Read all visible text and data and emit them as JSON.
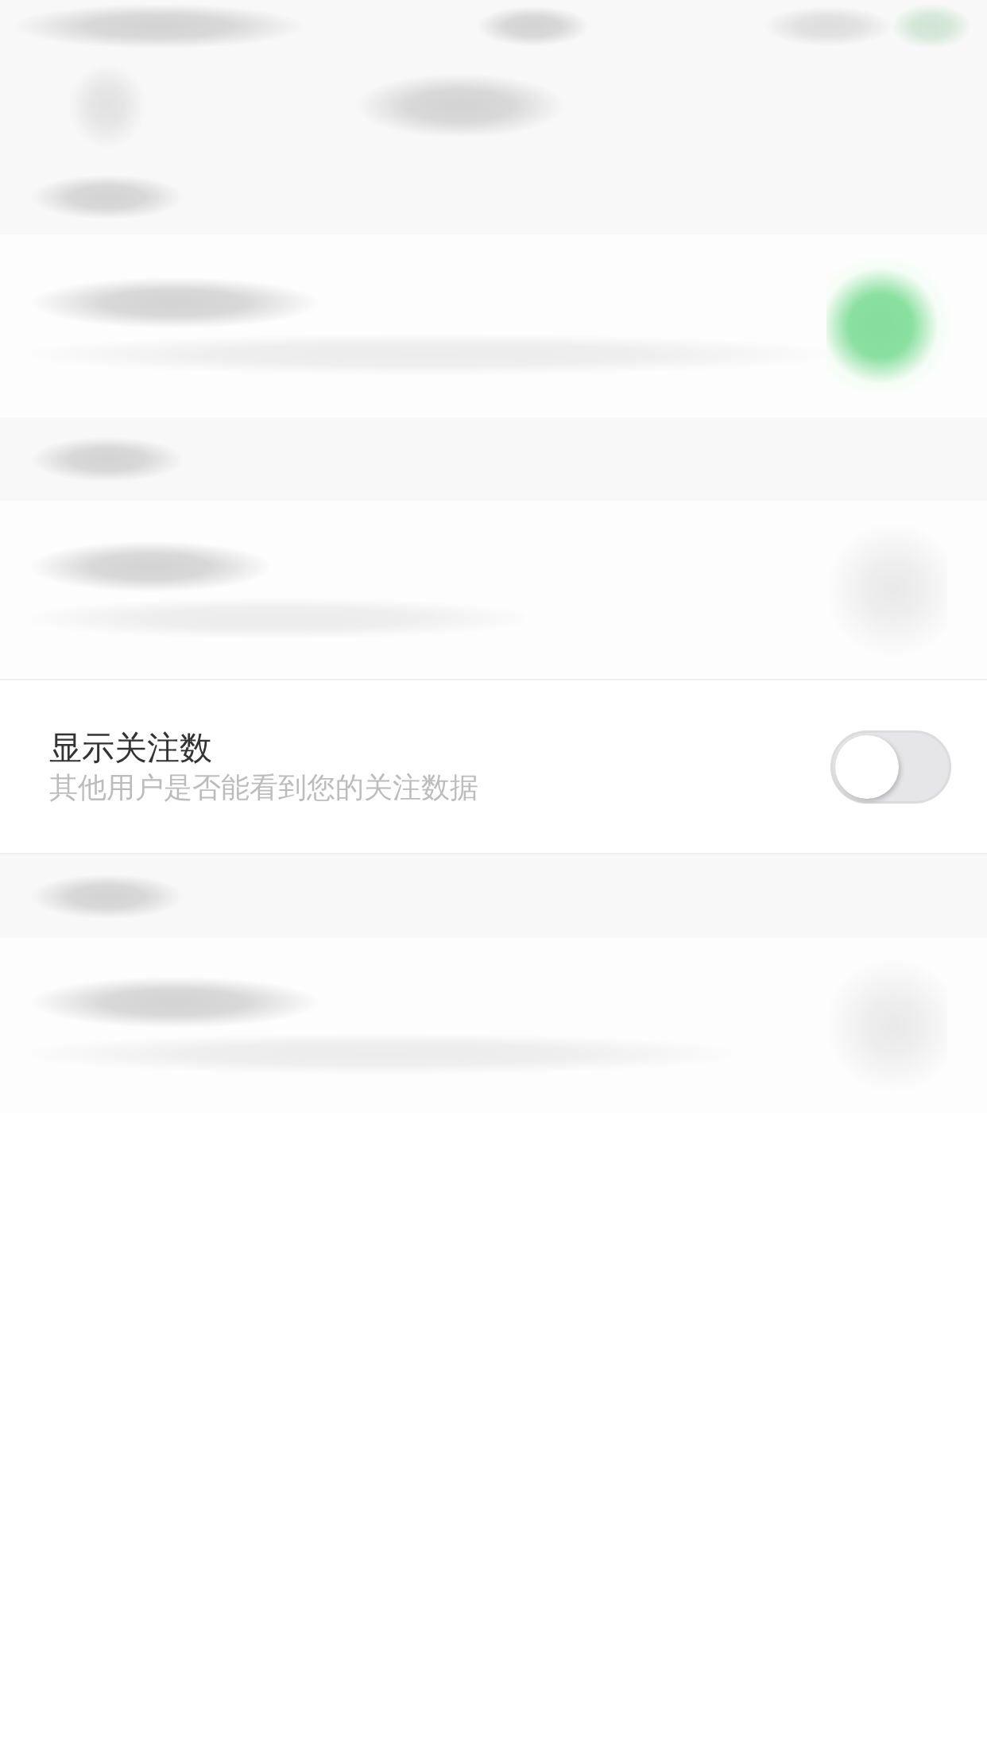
{
  "sections": [
    {
      "rows": [
        {
          "kind": "blurred",
          "on": true
        }
      ]
    },
    {
      "rows": [
        {
          "kind": "blurred",
          "on": false
        },
        {
          "kind": "visible",
          "title": "显示关注数",
          "subtitle": "其他用户是否能看到您的关注数据",
          "on": false
        }
      ]
    },
    {
      "rows": [
        {
          "kind": "blurred",
          "on": false
        }
      ]
    }
  ]
}
